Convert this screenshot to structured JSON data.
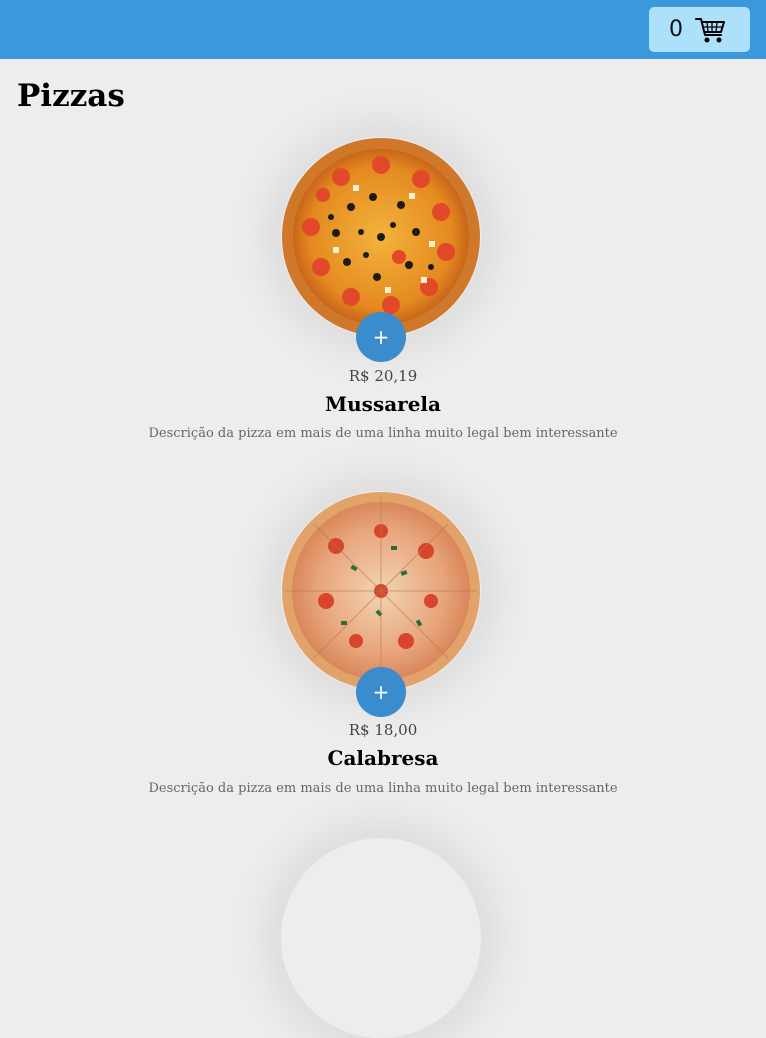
{
  "header": {
    "cart_count": "0",
    "cart_icon": "shopping-cart-icon"
  },
  "page": {
    "title": "Pizzas"
  },
  "products": [
    {
      "add_label": "+",
      "price": "R$ 20,19",
      "name": "Mussarela",
      "description": "Descrição da pizza em mais de uma linha muito legal bem interessante"
    },
    {
      "add_label": "+",
      "price": "R$ 18,00",
      "name": "Calabresa",
      "description": "Descrição da pizza em mais de uma linha muito legal bem interessante"
    }
  ],
  "colors": {
    "header": "#3a98dc",
    "cart_button": "#ade0fb",
    "add_button": "#3a8ccc",
    "background": "#ededed"
  }
}
